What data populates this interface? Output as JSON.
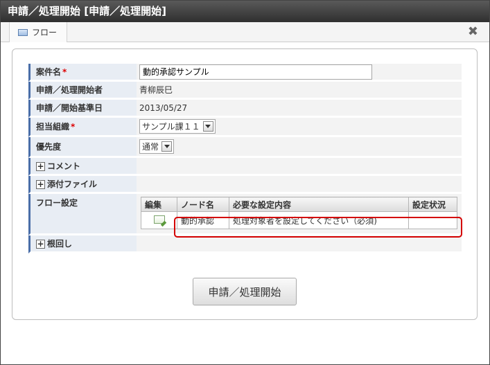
{
  "window": {
    "title": "申請／処理開始 [申請／処理開始]"
  },
  "tabs": [
    {
      "label": "フロー",
      "icon": "flow-window-icon"
    }
  ],
  "close_icon": "✖",
  "form": {
    "matter_name": {
      "label": "案件名",
      "required_mark": "*",
      "value": "動的承認サンプル"
    },
    "applicant": {
      "label": "申請／処理開始者",
      "value": "青柳辰巳"
    },
    "base_date": {
      "label": "申請／開始基準日",
      "value": "2013/05/27"
    },
    "org": {
      "label": "担当組織",
      "required_mark": "*",
      "selected": "サンプル課１１"
    },
    "priority": {
      "label": "優先度",
      "selected": "通常"
    },
    "comment": {
      "label": "コメント",
      "toggle": "+"
    },
    "attachment": {
      "label": "添付ファイル",
      "toggle": "+"
    },
    "flow": {
      "label": "フロー設定",
      "columns": [
        "編集",
        "ノード名",
        "必要な設定内容",
        "設定状況"
      ],
      "rows": [
        {
          "node": "動的承認",
          "requirement": "処理対象者を設定してください（必須)",
          "status": ""
        }
      ]
    },
    "nemawashi": {
      "label": "根回し",
      "toggle": "+"
    }
  },
  "submit": {
    "label": "申請／処理開始"
  },
  "colors": {
    "highlight": "#d40000",
    "label_accent": "#4a6ea8"
  }
}
